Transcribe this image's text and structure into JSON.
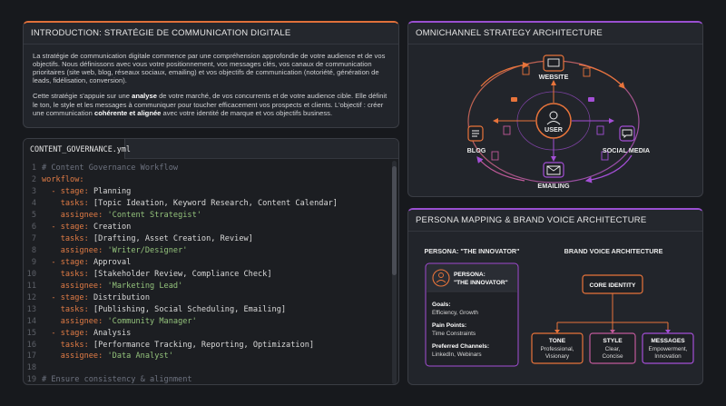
{
  "intro": {
    "title": "INTRODUCTION: STRATÉGIE DE COMMUNICATION DIGITALE",
    "p1": "La stratégie de communication digitale commence par une compréhension approfondie de votre audience et de vos objectifs. Nous définissons avec vous votre positionnement, vos messages clés, vos canaux de communication prioritaires (site web, blog, réseaux sociaux, emailing) et vos objectifs de communication (notoriété, génération de leads, fidélisation, conversion).",
    "p2_a": "Cette stratégie s'appuie sur une ",
    "p2_b": "analyse",
    "p2_c": " de votre marché, de vos concurrents et de votre audience cible. Elle définit le ton, le style et les messages à communiquer pour toucher efficacement vos prospects et clients. L'objectif : créer une communication ",
    "p2_d": "cohérente et alignée",
    "p2_e": " avec votre identité de marque et vos objectifs business."
  },
  "editor": {
    "tab": "CONTENT_GOVERNANCE.yml",
    "lines": [
      {
        "n": "1",
        "indent": "",
        "dash": "",
        "key": "",
        "val": "",
        "str": "",
        "com": "# Content Governance Workflow"
      },
      {
        "n": "2",
        "indent": "",
        "dash": "",
        "key": "workflow:",
        "val": "",
        "str": "",
        "com": ""
      },
      {
        "n": "3",
        "indent": "  ",
        "dash": "- ",
        "key": "stage:",
        "val": " Planning",
        "str": "",
        "com": ""
      },
      {
        "n": "4",
        "indent": "    ",
        "dash": "",
        "key": "tasks:",
        "val": " [Topic Ideation, Keyword Research, Content Calendar]",
        "str": "",
        "com": ""
      },
      {
        "n": "5",
        "indent": "    ",
        "dash": "",
        "key": "assignee:",
        "val": " ",
        "str": "'Content Strategist'",
        "com": ""
      },
      {
        "n": "6",
        "indent": "  ",
        "dash": "- ",
        "key": "stage:",
        "val": " Creation",
        "str": "",
        "com": ""
      },
      {
        "n": "7",
        "indent": "    ",
        "dash": "",
        "key": "tasks:",
        "val": " [Drafting, Asset Creation, Review]",
        "str": "",
        "com": ""
      },
      {
        "n": "8",
        "indent": "    ",
        "dash": "",
        "key": "assignee:",
        "val": " ",
        "str": "'Writer/Designer'",
        "com": ""
      },
      {
        "n": "9",
        "indent": "  ",
        "dash": "- ",
        "key": "stage:",
        "val": " Approval",
        "str": "",
        "com": ""
      },
      {
        "n": "10",
        "indent": "    ",
        "dash": "",
        "key": "tasks:",
        "val": " [Stakeholder Review, Compliance Check]",
        "str": "",
        "com": ""
      },
      {
        "n": "11",
        "indent": "    ",
        "dash": "",
        "key": "assignee:",
        "val": " ",
        "str": "'Marketing Lead'",
        "com": ""
      },
      {
        "n": "12",
        "indent": "  ",
        "dash": "- ",
        "key": "stage:",
        "val": " Distribution",
        "str": "",
        "com": ""
      },
      {
        "n": "13",
        "indent": "    ",
        "dash": "",
        "key": "tasks:",
        "val": " [Publishing, Social Scheduling, Emailing]",
        "str": "",
        "com": ""
      },
      {
        "n": "14",
        "indent": "    ",
        "dash": "",
        "key": "assignee:",
        "val": " ",
        "str": "'Community Manager'",
        "com": ""
      },
      {
        "n": "15",
        "indent": "  ",
        "dash": "- ",
        "key": "stage:",
        "val": " Analysis",
        "str": "",
        "com": ""
      },
      {
        "n": "16",
        "indent": "    ",
        "dash": "",
        "key": "tasks:",
        "val": " [Performance Tracking, Reporting, Optimization]",
        "str": "",
        "com": ""
      },
      {
        "n": "17",
        "indent": "    ",
        "dash": "",
        "key": "assignee:",
        "val": " ",
        "str": "'Data Analyst'",
        "com": ""
      },
      {
        "n": "18",
        "indent": "",
        "dash": "",
        "key": "",
        "val": "",
        "str": "",
        "com": ""
      },
      {
        "n": "19",
        "indent": "",
        "dash": "",
        "key": "",
        "val": "",
        "str": "",
        "com": "# Ensure consistency & alignment"
      }
    ]
  },
  "omni": {
    "title": "OMNICHANNEL STRATEGY ARCHITECTURE",
    "center": "USER",
    "website": "WEBSITE",
    "blog": "BLOG",
    "social": "SOCIAL MEDIA",
    "emailing": "EMAILING",
    "colors": {
      "orange": "#e8743b",
      "purple": "#a44fd6"
    }
  },
  "persona": {
    "title": "PERSONA MAPPING & BRAND VOICE ARCHITECTURE",
    "section_left": "PERSONA: \"THE INNOVATOR\"",
    "section_right": "BRAND VOICE ARCHITECTURE",
    "card_title_1": "PERSONA:",
    "card_title_2": "\"THE INNOVATOR\"",
    "goals_label": "Goals:",
    "goals_value": "Efficiency, Growth",
    "pain_label": "Pain Points:",
    "pain_value": "Time Constraints",
    "channels_label": "Preferred Channels:",
    "channels_value": "LinkedIn, Webinars",
    "core": "CORE IDENTITY",
    "tone_label": "TONE",
    "tone_value_1": "Professional,",
    "tone_value_2": "Visionary",
    "style_label": "STYLE",
    "style_value_1": "Clear,",
    "style_value_2": "Concise",
    "messages_label": "MESSAGES",
    "messages_value_1": "Empowerment,",
    "messages_value_2": "Innovation"
  }
}
